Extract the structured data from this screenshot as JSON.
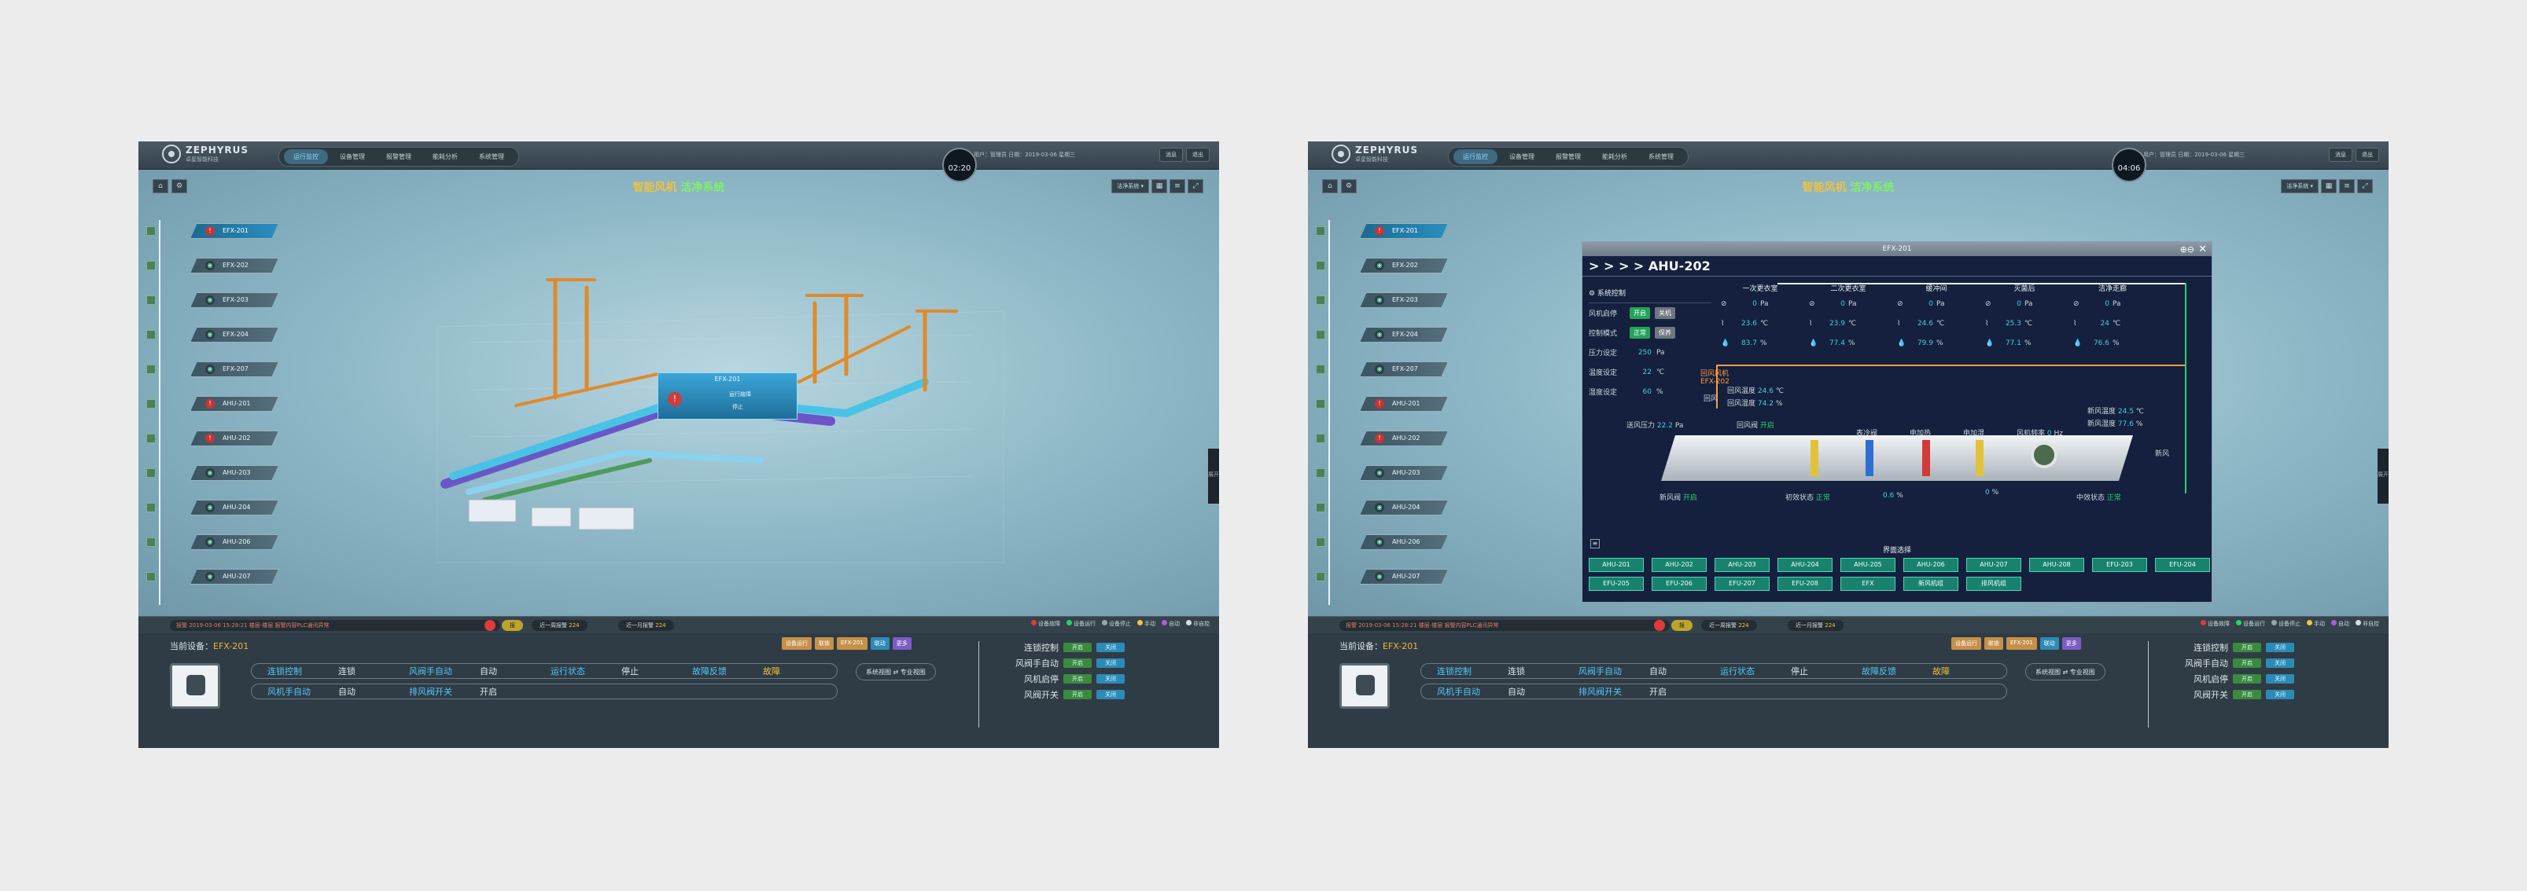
{
  "brand": {
    "name": "ZEPHYRUS",
    "sub": "卓星智能科技"
  },
  "nav": [
    "运行监控",
    "设备管理",
    "报警管理",
    "能耗分析",
    "系统管理"
  ],
  "screens": [
    {
      "clock": "02:20",
      "user": "用户：管理员 日期：2019-03-06 星期三"
    },
    {
      "clock": "04:06",
      "user": "用户：管理员 日期：2019-03-06 星期三"
    }
  ],
  "top_buttons": [
    "消息",
    "退出"
  ],
  "stage": {
    "title_a": "智能风机",
    "title_b": "洁净系统",
    "system_select": "洁净系统 ▾"
  },
  "tree": [
    {
      "label": "EFX-201",
      "warn": true
    },
    {
      "label": "EFX-202",
      "warn": false
    },
    {
      "label": "EFX-203",
      "warn": false
    },
    {
      "label": "EFX-204",
      "warn": false
    },
    {
      "label": "EFX-207",
      "warn": false
    },
    {
      "label": "AHU-201",
      "warn": true
    },
    {
      "label": "AHU-202",
      "warn": true
    },
    {
      "label": "AHU-203",
      "warn": false
    },
    {
      "label": "AHU-204",
      "warn": false
    },
    {
      "label": "AHU-206",
      "warn": false
    },
    {
      "label": "AHU-207",
      "warn": false
    }
  ],
  "popup": {
    "title": "EFX-201",
    "line1": "运行故障",
    "line2": "停止"
  },
  "side_tab": "展开",
  "status": {
    "alarm": "报警  2019-03-06 15:28:21  楼层-楼层  报警内容PLC通讯异常",
    "count_label": "报",
    "week_label": "近一周报警",
    "week_count": "224",
    "month_label": "近一月报警",
    "month_count": "224",
    "legend": [
      "设备故障",
      "设备运行",
      "设备停止",
      "手动",
      "自动",
      "非自控"
    ]
  },
  "bottom": {
    "current_label": "当前设备：",
    "current_value": "EFX-201",
    "tags": [
      "设备运行",
      "联锁",
      "EFX-201",
      "联动",
      "更多"
    ],
    "row1": [
      {
        "k": "连锁控制",
        "v": "连锁"
      },
      {
        "k": "风阀手自动",
        "v": "自动"
      },
      {
        "k": "运行状态",
        "v": "停止"
      },
      {
        "k": "故障反馈",
        "v": "故障"
      }
    ],
    "row2": [
      {
        "k": "风机手自动",
        "v": "自动"
      },
      {
        "k": "排风阀开关",
        "v": "开启"
      }
    ],
    "mode_button": "系统视图 ⇄ 专业视图",
    "controls": [
      "连锁控制",
      "风阀手自动",
      "风机启停",
      "风阀开关"
    ],
    "pill_a": "开启",
    "pill_b": "关闭"
  },
  "panel": {
    "window_title": "EFX-201",
    "heading": "> > > > AHU-202",
    "sysctl_title": "系统控制",
    "sysctl": [
      {
        "k": "风机启停",
        "a": "开启",
        "b": "关机"
      },
      {
        "k": "控制模式",
        "a": "正常",
        "b": "保养"
      }
    ],
    "setpoints": [
      {
        "k": "压力设定",
        "v": "250",
        "u": "Pa"
      },
      {
        "k": "温度设定",
        "v": "22",
        "u": "℃"
      },
      {
        "k": "湿度设定",
        "v": "60",
        "u": "%"
      }
    ],
    "sections": [
      {
        "t": "一次更衣室",
        "p": "0",
        "temp": "23.6",
        "hum": "83.7"
      },
      {
        "t": "二次更衣室",
        "p": "0",
        "temp": "23.9",
        "hum": "77.4"
      },
      {
        "t": "缓冲间",
        "p": "0",
        "temp": "24.6",
        "hum": "79.9"
      },
      {
        "t": "灭菌后",
        "p": "0",
        "temp": "25.3",
        "hum": "77.1"
      },
      {
        "t": "洁净走廊",
        "p": "0",
        "temp": "24",
        "hum": "76.6"
      }
    ],
    "units": {
      "p": "Pa",
      "t": "℃",
      "h": "%"
    },
    "labels": {
      "return_fan": "回风风机",
      "return_fan_id": "EFX-202",
      "return_temp": "回风温度",
      "return_temp_v": "24.6",
      "return_hum": "回风湿度",
      "return_hum_v": "74.2",
      "supply_pressure": "送风压力",
      "supply_pressure_v": "22.2",
      "return_air": "回风",
      "return_damper": "回风阀",
      "return_damper_v": "开启",
      "cooling_valve": "表冷阀",
      "heater": "电加热",
      "humidifier": "电加湿",
      "fan_freq": "风机频率",
      "fan_freq_v": "0",
      "fan_freq_u": "Hz",
      "fresh_temp": "新风温度",
      "fresh_temp_v": "24.5",
      "fresh_hum": "新风湿度",
      "fresh_hum_v": "77.6",
      "fresh_air": "新风",
      "fresh_damper": "新风阀",
      "fresh_damper_v": "开启",
      "prefilter": "初效状态",
      "prefilter_v": "正常",
      "valve_v": "0.6",
      "valve_u": "%",
      "heater_v": "0",
      "mid_filter": "中效状态",
      "mid_filter_v": "正常"
    },
    "select_title": "界面选择",
    "pages_row1": [
      "AHU-201",
      "AHU-202",
      "AHU-203",
      "AHU-204",
      "AHU-205",
      "AHU-206",
      "AHU-207",
      "AHU-208",
      "EFU-203",
      "EFU-204"
    ],
    "pages_row2": [
      "EFU-205",
      "EFU-206",
      "EFU-207",
      "EFU-208",
      "EFX",
      "新风机组",
      "排风机组"
    ]
  }
}
